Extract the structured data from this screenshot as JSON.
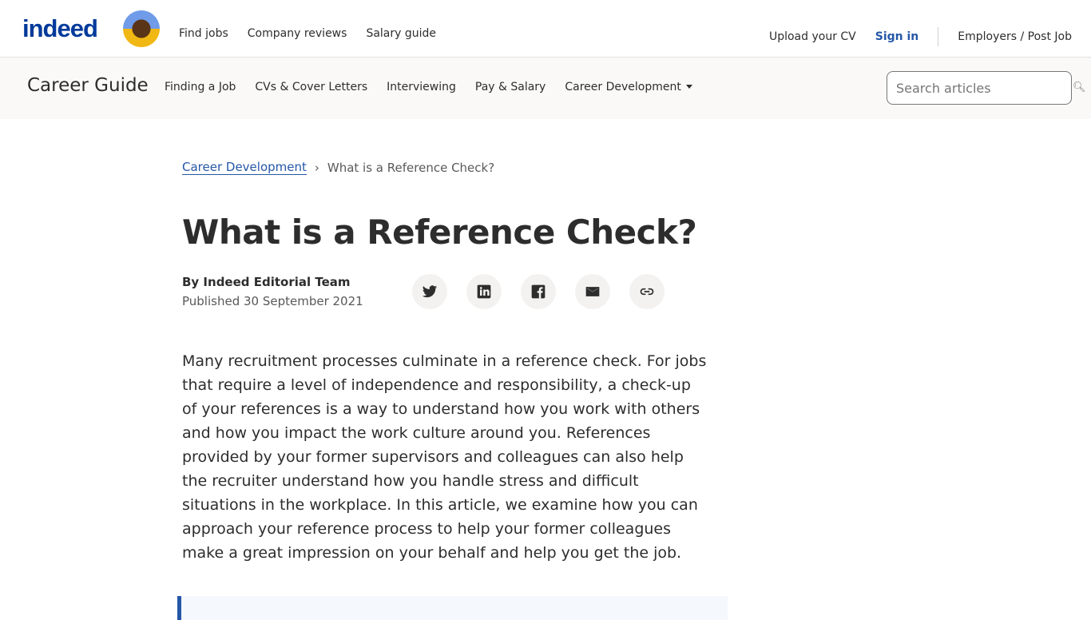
{
  "header": {
    "logo": "indeed",
    "nav": [
      "Find jobs",
      "Company reviews",
      "Salary guide"
    ],
    "upload": "Upload your CV",
    "signin": "Sign in",
    "employers": "Employers / Post Job"
  },
  "subnav": {
    "title": "Career Guide",
    "items": [
      "Finding a Job",
      "CVs & Cover Letters",
      "Interviewing",
      "Pay & Salary",
      "Career Development"
    ],
    "search_placeholder": "Search articles"
  },
  "breadcrumb": {
    "parent": "Career Development",
    "current": "What is a Reference Check?"
  },
  "article": {
    "title": "What is a Reference Check?",
    "author": "By Indeed Editorial Team",
    "published": "Published 30 September 2021",
    "share": [
      "twitter",
      "linkedin",
      "facebook",
      "email",
      "link"
    ],
    "intro": "Many recruitment processes culminate in a reference check. For jobs that require a level of independence and responsibility, a check-up of your references is a way to understand how you work with others and how you impact the work culture around you. References provided by your former supervisors and colleagues can also help the recruiter understand how you handle stress and difficult situations in the workplace. In this article, we examine how you can approach your reference process to help your former colleagues make a great impression on your behalf and help you get the job."
  },
  "colors": {
    "brand": "#003a9b",
    "link": "#2557a7"
  }
}
